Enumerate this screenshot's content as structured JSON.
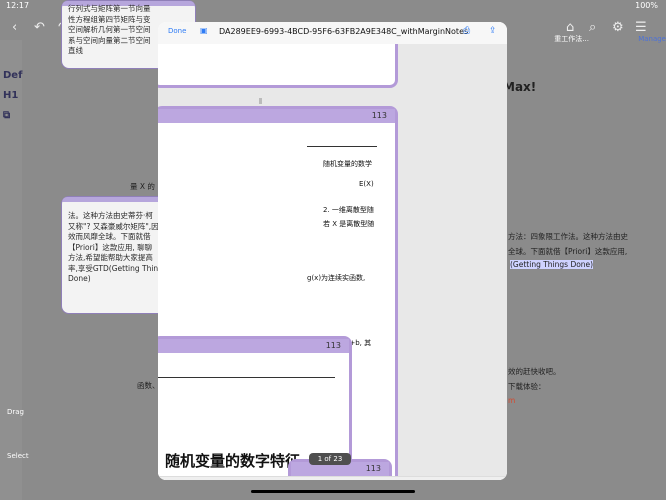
{
  "status": {
    "time": "12:17",
    "battery": "100%"
  },
  "background": {
    "left_card_1_text": "行列式与矩阵第一节向量\n性方程组第四节矩阵与变\n空间解析几何第一节空间\n系与空间向量第二节空间\n直线",
    "left_card_2_text": "法。这种方法由史蒂芬·柯\n又称\"? 又森豪威尔矩阵\",因\n效而风靡全球。下面就借\n【Priori】这款应用, 聊聊\n方法,希望能帮助大家提高\n率,享受GTD(Getting Thin\nDone)",
    "snippet_1": "量 X 的",
    "snippet_2": "函数、",
    "right_tab": "重工作法...",
    "right_manage": "Manage",
    "right_max": "Max!",
    "right_line_1": "方法：四象限工作法。这种方法由史",
    "right_line_2": "全球。下面就借【Priori】这款应用,",
    "right_line_3": "(Getting Things Done)",
    "right_line_4": "效的赶快收吧。",
    "right_line_5": "下载体验：",
    "right_line_6": "m"
  },
  "rail": {
    "drag": "Drag",
    "select": "Select",
    "def": "Def",
    "h1": "H1"
  },
  "modal": {
    "done": "Done",
    "title": "DA289EE9-6993-4BCD-95F6-63FB2A9E348C_withMarginNotes",
    "page_indicator": "1 of 23",
    "pages": [
      {
        "number": "113"
      },
      {
        "number": "113"
      },
      {
        "number": "113"
      }
    ],
    "page_lines": {
      "line_1": "随机变量的数学",
      "line_2": "E(X)",
      "line_3": "2. 一维离散型随",
      "line_4": "若 X 是离散型随",
      "line_5": "g(x)为连续实函数,",
      "line_6": "/+b, 其",
      "line_7": "随机变量的数字特征"
    }
  },
  "icons": {
    "back": "chevron-left-icon",
    "undo": "undo-icon",
    "redo": "redo-icon",
    "list": "list-icon",
    "edit": "edit-icon",
    "share": "share-icon",
    "print": "print-icon",
    "page": "document-icon"
  }
}
